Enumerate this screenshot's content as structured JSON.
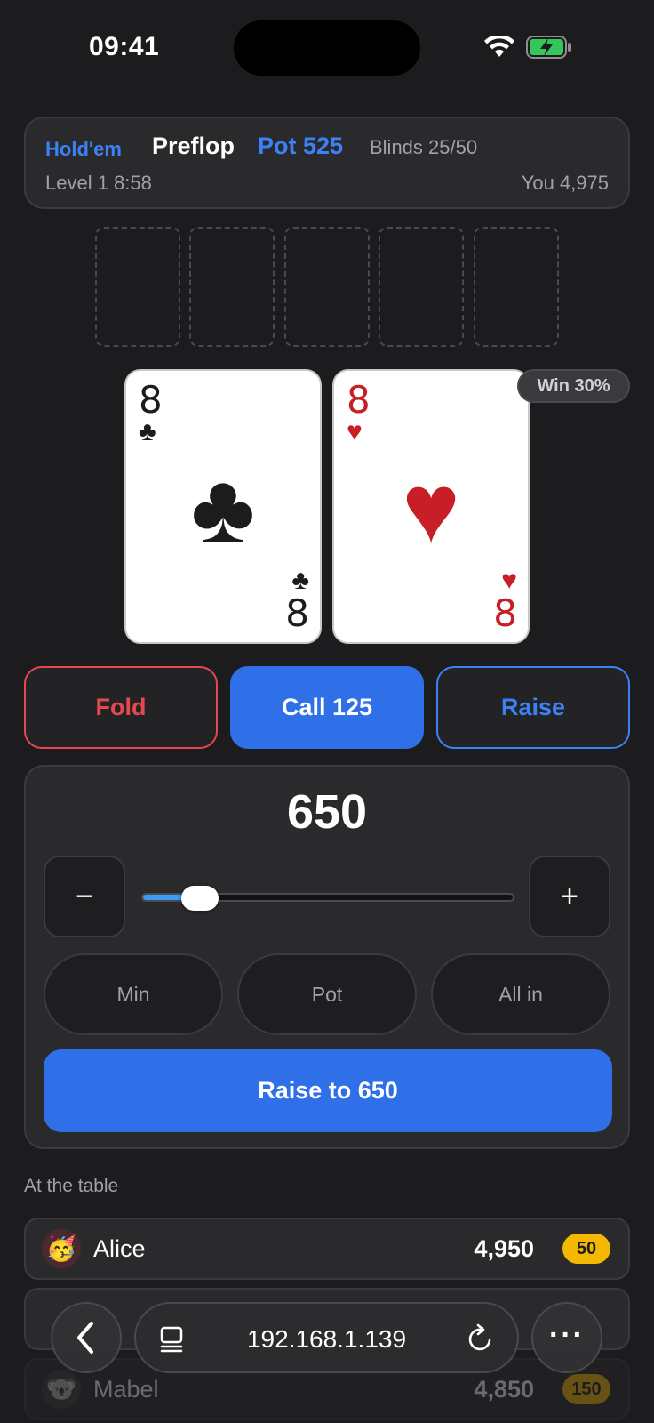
{
  "status_bar": {
    "time": "09:41"
  },
  "header": {
    "game_type": "Hold'em",
    "street": "Preflop",
    "pot": "Pot 525",
    "blinds": "Blinds 25/50",
    "level": "Level 1 8:58",
    "you": "You 4,975"
  },
  "board": {
    "slots": 5
  },
  "hole_cards": [
    {
      "rank": "8",
      "suit": "♣",
      "color": "#1c1c1e"
    },
    {
      "rank": "8",
      "suit": "♥",
      "color": "#c81e28"
    }
  ],
  "win_badge": "Win 30%",
  "actions": {
    "fold": "Fold",
    "call": "Call 125",
    "raise": "Raise"
  },
  "raise_panel": {
    "amount": "650",
    "minus": "−",
    "plus": "+",
    "slider_fraction": 0.12,
    "presets": {
      "min": "Min",
      "pot": "Pot",
      "all_in": "All in"
    },
    "confirm": "Raise to 650"
  },
  "players_section": {
    "label": "At the table",
    "players": [
      {
        "name": "Alice",
        "avatar": "🥳",
        "stack": "4,950",
        "bet": "50"
      },
      {
        "name": "Mabel",
        "avatar": "🐨",
        "stack": "4,850",
        "bet": "150"
      }
    ]
  },
  "browser": {
    "url": "192.168.1.139",
    "more": "···"
  },
  "colors": {
    "accent": "#2f6fe8",
    "fold": "#e5484d",
    "chip": "#f5b800",
    "background": "#1c1c1e"
  }
}
